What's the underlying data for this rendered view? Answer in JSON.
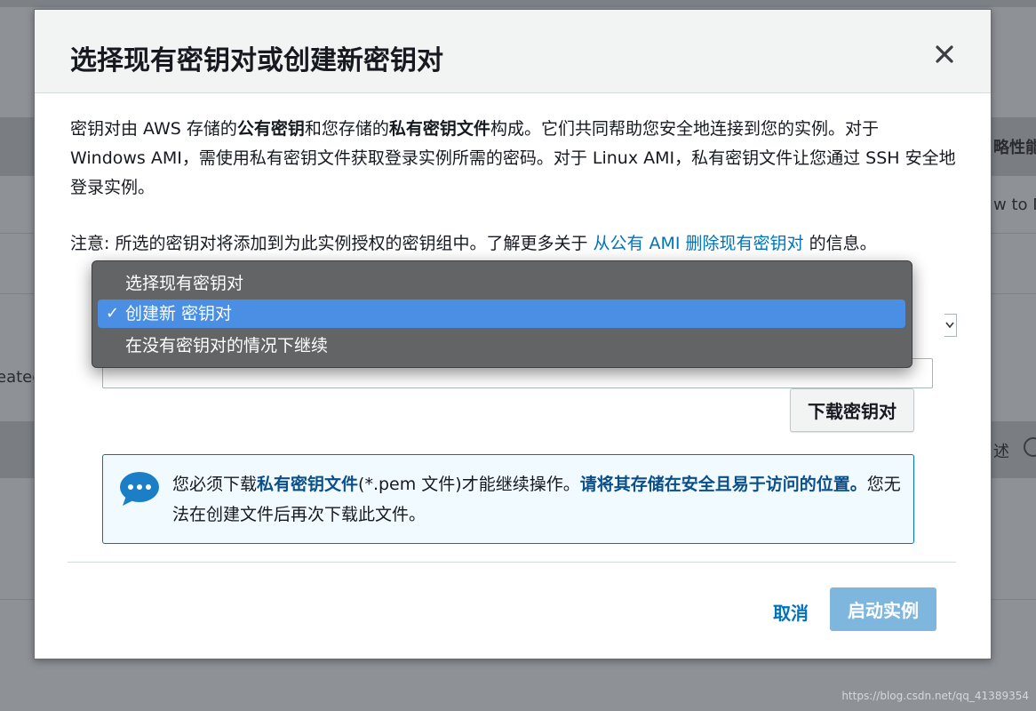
{
  "background": {
    "right_header_text": "略性能",
    "right_row_text": "w to M",
    "left_row_text": "eated",
    "right_desc_text": "述"
  },
  "modal": {
    "title": "选择现有密钥对或创建新密钥对",
    "close_icon": "close-icon",
    "intro": {
      "part1": "密钥对由 AWS 存储的",
      "bold1": "公有密钥",
      "part2": "和您存储的",
      "bold2": "私有密钥文件",
      "part3": "构成。它们共同帮助您安全地连接到您的实例。对于 Windows AMI，需使用私有密钥文件获取登录实例所需的密码。对于 Linux AMI，私有密钥文件让您通过 SSH 安全地登录实例。"
    },
    "note": {
      "prefix": "注意: 所选的密钥对将添加到为此实例授权的密钥组中。了解更多关于 ",
      "link": "从公有 AMI 删除现有密钥对",
      "suffix": " 的信息。"
    },
    "download_button": "下载密钥对",
    "alert": {
      "icon": "chat-bubble-icon",
      "part1": "您必须下载",
      "bold1": "私有密钥文件",
      "part2": "(*.pem 文件)才能继续操作。",
      "bold2": "请将其存储在安全且易于访问的位置。",
      "part3": "您无法在创建文件后再次下载此文件。"
    },
    "cancel_label": "取消",
    "launch_label": "启动实例"
  },
  "dropdown": {
    "options": [
      "选择现有密钥对",
      "创建新 密钥对",
      "在没有密钥对的情况下继续"
    ],
    "selected_index": 1,
    "check_mark": "✓"
  },
  "watermark": "https://blog.csdn.net/qq_41389354",
  "colors": {
    "accent": "#0073bb",
    "selection": "#4a8fe3",
    "primary_disabled": "#7fb6dd"
  }
}
